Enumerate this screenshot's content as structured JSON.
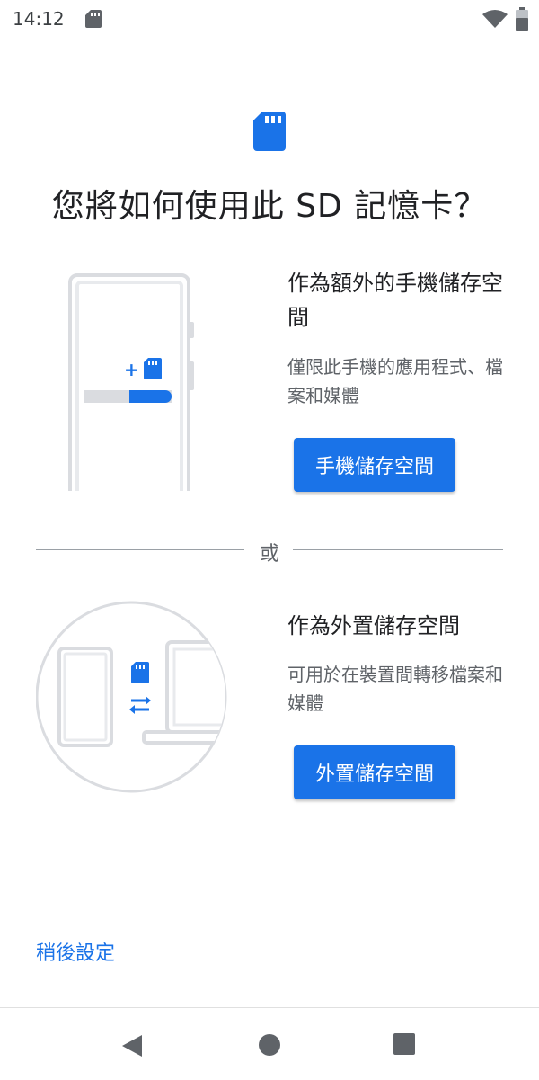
{
  "status_bar": {
    "time": "14:12",
    "icons": [
      "sd-card-icon",
      "wifi-icon",
      "battery-icon"
    ]
  },
  "header": {
    "icon": "sd-card-icon",
    "title": "您將如何使用此 SD 記憶卡？"
  },
  "options": [
    {
      "illustration": "phone-sd-add-illustration",
      "title": "作為額外的手機儲存空間",
      "description": "僅限此手機的應用程式、檔案和媒體",
      "button_label": "手機儲存空間"
    },
    {
      "illustration": "transfer-between-devices-illustration",
      "title": "作為外置儲存空間",
      "description": "可用於在裝置間轉移檔案和媒體",
      "button_label": "外置儲存空間"
    }
  ],
  "divider_label": "或",
  "footer": {
    "setup_later": "稍後設定"
  },
  "nav_bar": {
    "icons": [
      "back-icon",
      "home-icon",
      "recents-icon"
    ]
  },
  "colors": {
    "accent": "#1a73e8",
    "text_primary": "#202124",
    "text_secondary": "#5f6368",
    "illustration_gray": "#dadce0"
  }
}
